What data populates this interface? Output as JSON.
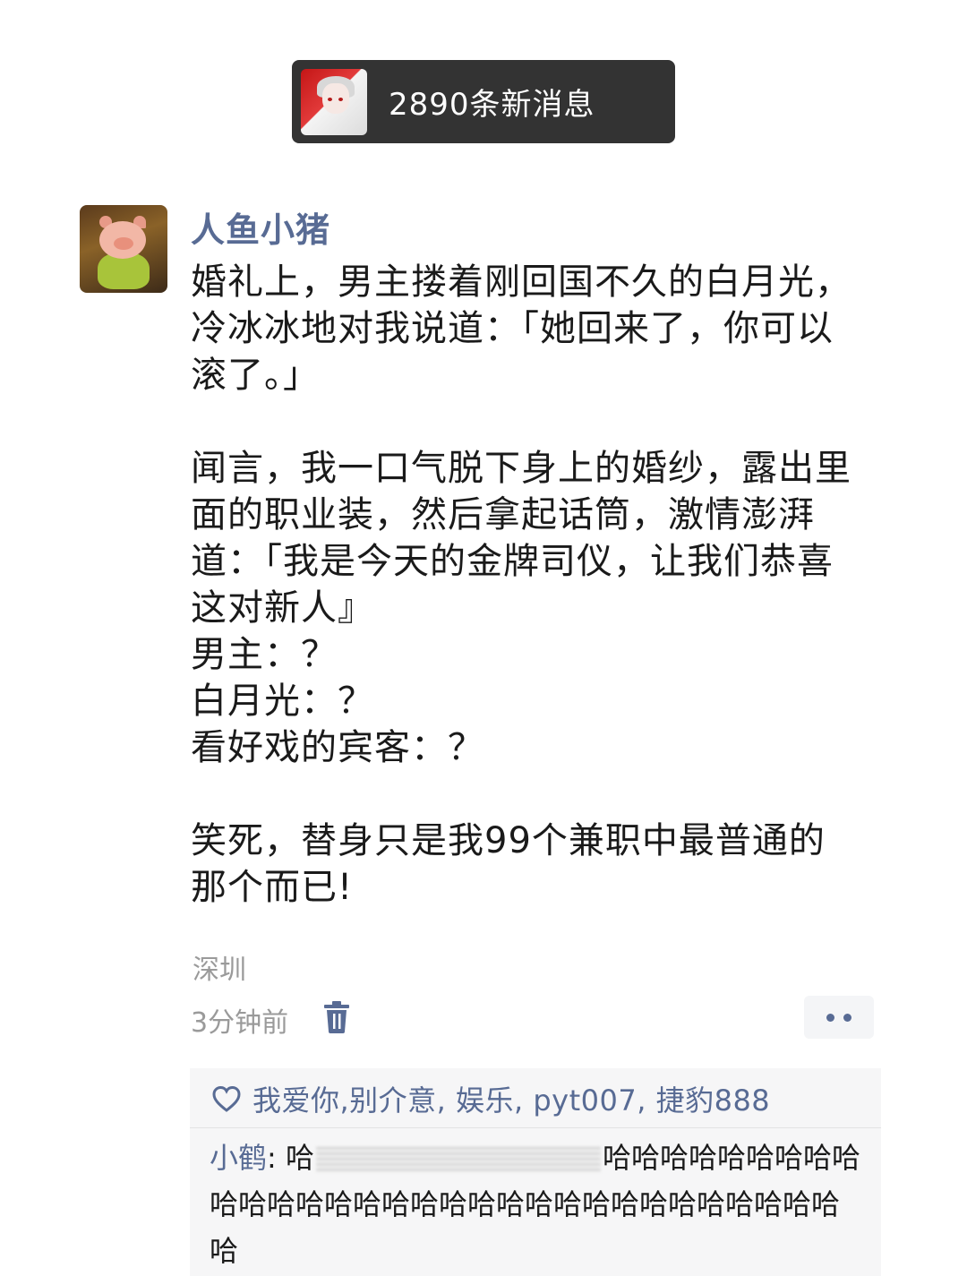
{
  "notification": {
    "text": "2890条新消息",
    "avatar_icon": "anime-girl-avatar"
  },
  "post": {
    "author": "人鱼小猪",
    "avatar_icon": "pig-figurine-avatar",
    "content": "婚礼上，男主搂着刚回国不久的白月光，\n冷冰冰地对我说道：「她回来了，你可以\n滚了。」\n\n闻言，我一口气脱下身上的婚纱，露出里\n面的职业装，然后拿起话筒，激情澎湃\n道：「我是今天的金牌司仪，让我们恭喜\n这对新人』\n男主：？\n白月光：？\n看好戏的宾客：？\n\n笑死，替身只是我99个兼职中最普通的\n那个而已!",
    "location": "深圳",
    "time": "3分钟前"
  },
  "likes": {
    "names": "我爱你,别介意, 娱乐, pyt007, 捷豹888"
  },
  "comment": {
    "author": "小鹤",
    "separator": ": ",
    "text_start": "哈",
    "text_rest": "哈哈哈哈哈哈哈哈哈哈哈哈哈哈哈哈哈哈哈哈哈哈哈哈哈哈哈哈哈哈哈哈"
  },
  "colors": {
    "link_blue": "#586b94",
    "notice_bg": "#333333"
  }
}
